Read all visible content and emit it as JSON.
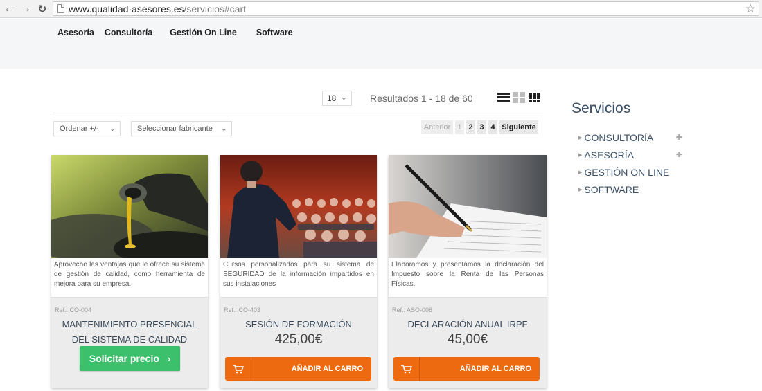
{
  "browser": {
    "url_host": "www.qualidad-asesores.es",
    "url_path": "/servicios#cart"
  },
  "nav": {
    "items": [
      {
        "label": "Asesoría"
      },
      {
        "label": "Consultoría"
      },
      {
        "label": "Gestión On Line"
      },
      {
        "label": "Software"
      }
    ]
  },
  "toolbar": {
    "per_page": "18",
    "results_text": "Resultados 1 - 18 de 60",
    "order_label": "Ordenar +/-",
    "manufacturer_label": "Seleccionar fabricante"
  },
  "pagination": {
    "prev": "Anterior",
    "pages": [
      "1",
      "2",
      "3",
      "4"
    ],
    "current": "1",
    "next": "Siguiente"
  },
  "products": [
    {
      "description": "Aproveche las ventajas que le ofrece su sistema de gestión de calidad, como herramienta de mejora para su empresa.",
      "ref": "Ref.: CO-004",
      "title": "MANTENIMIENTO PRESENCIAL DEL SISTEMA DE CALIDAD",
      "action": "Solicitar precio",
      "action_icon": "chevron-right-icon"
    },
    {
      "description": "Cursos personalizados para su sistema de SEGURIDAD de la información impartidos en sus instalaciones",
      "ref": "Ref.: CO-403",
      "title": "SESIÓN DE FORMACIÓN",
      "price": "425,00€",
      "action": "AÑADIR AL CARRO",
      "action_icon": "cart-icon"
    },
    {
      "description": "Elaboramos y presentamos la declaración del Impuesto sobre la Renta de las Personas Físicas.",
      "ref": "Ref.: ASO-006",
      "title": "DECLARACIÓN ANUAL IRPF",
      "price": "45,00€",
      "action": "AÑADIR AL CARRO",
      "action_icon": "cart-icon"
    }
  ],
  "sidebar": {
    "title": "Servicios",
    "items": [
      {
        "label": "CONSULTORÍA",
        "expandable": true
      },
      {
        "label": "ASESORÍA",
        "expandable": true
      },
      {
        "label": "GESTIÓN ON LINE",
        "expandable": false
      },
      {
        "label": "SOFTWARE",
        "expandable": false
      }
    ]
  },
  "colors": {
    "accent_green": "#3cc06b",
    "accent_orange": "#ee6a10",
    "link_blue": "#3a5068"
  }
}
